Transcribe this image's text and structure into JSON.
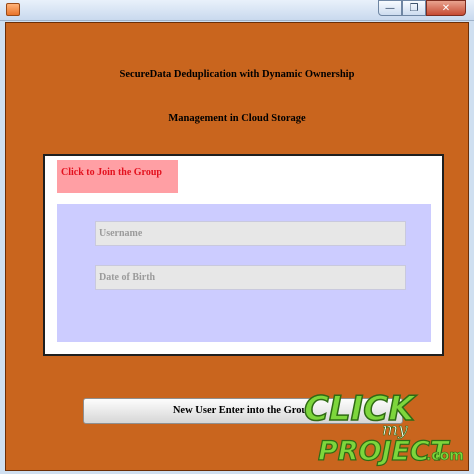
{
  "window": {
    "minimize_glyph": "—",
    "restore_glyph": "❐",
    "close_glyph": "✕"
  },
  "header": {
    "line1": "SecureData Deduplication with Dynamic Ownership",
    "line2": "Management in Cloud Storage"
  },
  "panel": {
    "join_button_label": "Click to Join the Group",
    "fields": {
      "username_placeholder": "Username",
      "dob_placeholder": "Date of Birth"
    }
  },
  "footer": {
    "submit_label": "New User Enter into the Group"
  },
  "watermark": {
    "word1": "CLICK",
    "word2": "my",
    "word3": "PROJECT",
    "word4": ".com"
  },
  "colors": {
    "frame": "#c9651e",
    "join_button_bg": "#ff9fa4",
    "join_button_text": "#e3111e",
    "form_area": "#ccccff"
  }
}
